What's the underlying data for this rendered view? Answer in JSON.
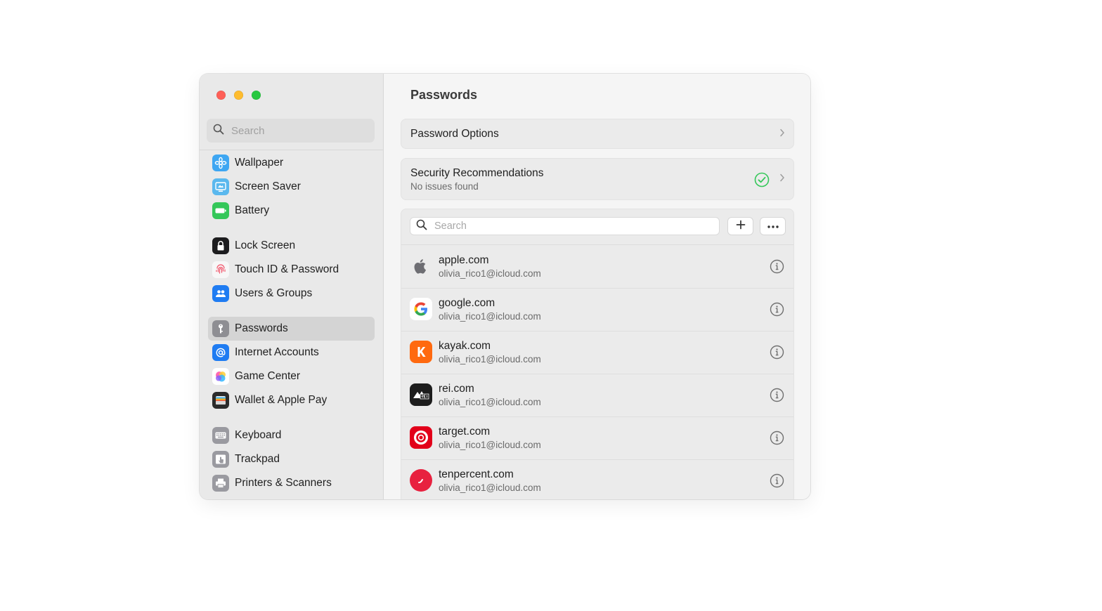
{
  "sidebar": {
    "search_placeholder": "Search",
    "items": [
      {
        "label": "Wallpaper",
        "icon": "wallpaper-icon"
      },
      {
        "label": "Screen Saver",
        "icon": "screen-saver-icon"
      },
      {
        "label": "Battery",
        "icon": "battery-icon"
      },
      {
        "label": "Lock Screen",
        "icon": "lock-icon"
      },
      {
        "label": "Touch ID & Password",
        "icon": "fingerprint-icon"
      },
      {
        "label": "Users & Groups",
        "icon": "users-icon"
      },
      {
        "label": "Passwords",
        "icon": "key-icon",
        "selected": true
      },
      {
        "label": "Internet Accounts",
        "icon": "at-icon"
      },
      {
        "label": "Game Center",
        "icon": "game-center-icon"
      },
      {
        "label": "Wallet & Apple Pay",
        "icon": "wallet-icon"
      },
      {
        "label": "Keyboard",
        "icon": "keyboard-icon"
      },
      {
        "label": "Trackpad",
        "icon": "trackpad-icon"
      },
      {
        "label": "Printers & Scanners",
        "icon": "printer-icon"
      }
    ]
  },
  "main": {
    "title": "Passwords",
    "password_options": "Password Options",
    "security": {
      "title": "Security Recommendations",
      "subtitle": "No issues found"
    },
    "list": {
      "search_placeholder": "Search",
      "add_icon": "plus-icon",
      "more_icon": "ellipsis-icon",
      "entries": [
        {
          "domain": "apple.com",
          "user": "olivia_rico1@icloud.com",
          "icon": "apple-logo-icon"
        },
        {
          "domain": "google.com",
          "user": "olivia_rico1@icloud.com",
          "icon": "google-logo-icon"
        },
        {
          "domain": "kayak.com",
          "user": "olivia_rico1@icloud.com",
          "icon": "kayak-logo-icon"
        },
        {
          "domain": "rei.com",
          "user": "olivia_rico1@icloud.com",
          "icon": "rei-logo-icon"
        },
        {
          "domain": "target.com",
          "user": "olivia_rico1@icloud.com",
          "icon": "target-logo-icon"
        },
        {
          "domain": "tenpercent.com",
          "user": "olivia_rico1@icloud.com",
          "icon": "tenpercent-logo-icon"
        }
      ]
    }
  },
  "colors": {
    "close": "#fe5f57",
    "minimize": "#febc2e",
    "maximize": "#28c840",
    "status_ok": "#34c759",
    "selection": "#d4d4d4"
  }
}
